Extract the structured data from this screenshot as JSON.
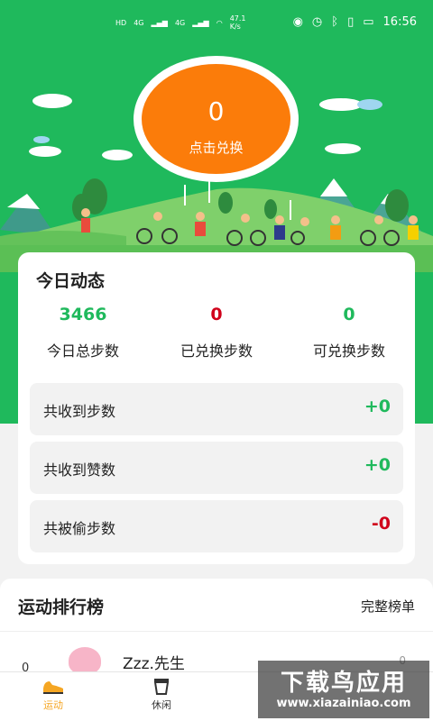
{
  "status_bar": {
    "left_tag": "HD",
    "net_4g": "4G",
    "net_4g_2": "4G",
    "speed": "47.1\nK/s",
    "time": "16:56"
  },
  "exchange": {
    "value": "0",
    "label": "点击兑换"
  },
  "today": {
    "title": "今日动态",
    "stats": [
      {
        "value": "3466",
        "label": "今日总步数",
        "color": "#1fb95c"
      },
      {
        "value": "0",
        "label": "已兑换步数",
        "color": "#d0021b"
      },
      {
        "value": "0",
        "label": "可兑换步数",
        "color": "#1fb95c"
      }
    ],
    "rows": [
      {
        "label": "共收到步数",
        "value": "+0",
        "color": "#1fb95c"
      },
      {
        "label": "共收到赞数",
        "value": "+0",
        "color": "#1fb95c"
      },
      {
        "label": "共被偷步数",
        "value": "-0",
        "color": "#d0021b"
      }
    ]
  },
  "ranking": {
    "title": "运动排行榜",
    "link": "完整榜单",
    "first_name": "Zzz.先生",
    "first_rank": "0",
    "first_steps": "0"
  },
  "tabs": [
    {
      "label": "运动",
      "icon": "shoe-icon",
      "active": true
    },
    {
      "label": "休闲",
      "icon": "cup-icon",
      "active": false
    }
  ],
  "watermark": {
    "main": "下载鸟应用",
    "sub": "www.xiazainiao.com"
  },
  "colors": {
    "brand_green": "#1fb95c",
    "orange": "#fb7c0a",
    "negative_red": "#d0021b",
    "tab_active": "#f5a623"
  }
}
